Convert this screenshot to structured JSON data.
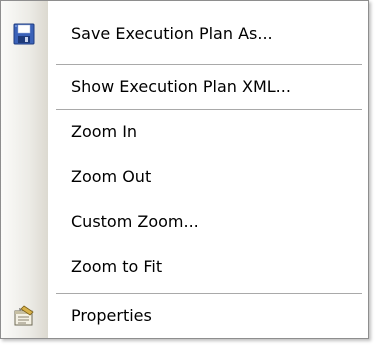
{
  "menu": {
    "items": [
      {
        "label": "Save Execution Plan As...",
        "icon": "floppy-disk-icon"
      },
      {
        "label": "Show Execution Plan XML...",
        "icon": ""
      },
      {
        "label": "Zoom In",
        "icon": ""
      },
      {
        "label": "Zoom Out",
        "icon": ""
      },
      {
        "label": "Custom Zoom...",
        "icon": ""
      },
      {
        "label": "Zoom to Fit",
        "icon": ""
      },
      {
        "label": "Properties",
        "icon": "properties-icon"
      }
    ]
  }
}
